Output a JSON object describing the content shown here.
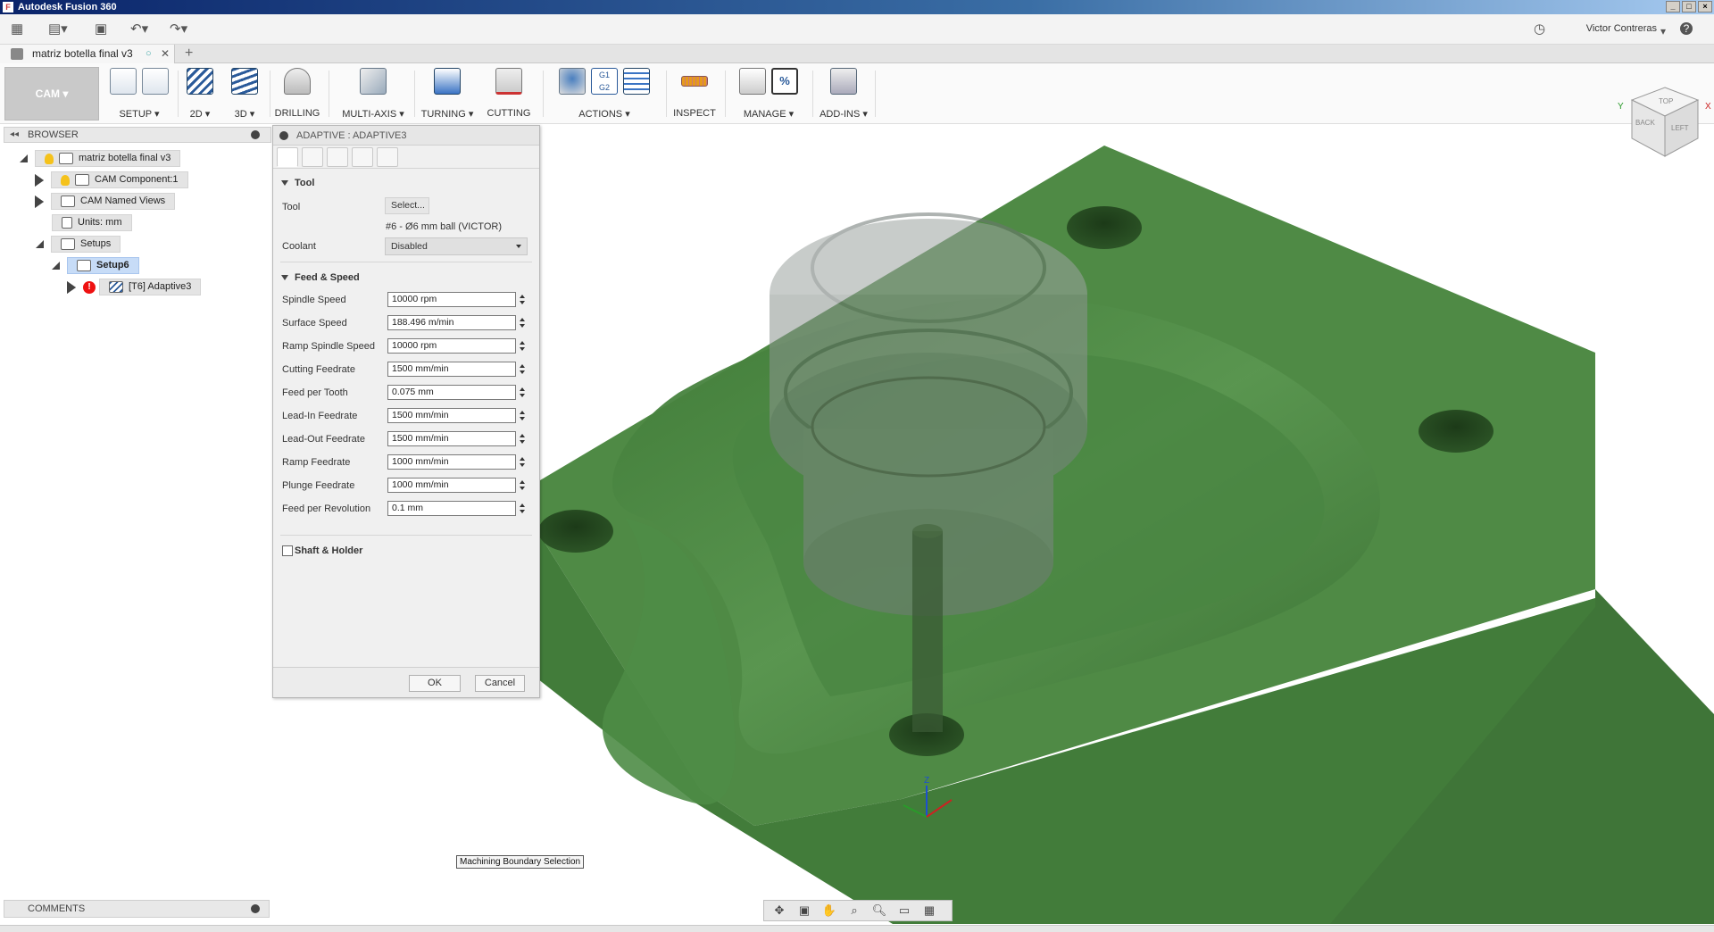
{
  "window": {
    "title": "Autodesk Fusion 360"
  },
  "appbar": {
    "user": "Victor Contreras",
    "help": "?"
  },
  "document_tab": {
    "name": "matriz botella final v3"
  },
  "toolbar": {
    "workspace": "CAM",
    "groups": [
      {
        "label": "SETUP"
      },
      {
        "label": "2D"
      },
      {
        "label": "3D"
      },
      {
        "label": "DRILLING"
      },
      {
        "label": "MULTI-AXIS"
      },
      {
        "label": "TURNING"
      },
      {
        "label": "CUTTING"
      },
      {
        "label": "ACTIONS"
      },
      {
        "label": "INSPECT"
      },
      {
        "label": "MANAGE"
      },
      {
        "label": "ADD-INS"
      }
    ]
  },
  "viewcube": {
    "faces": [
      "TOP",
      "BACK",
      "LEFT"
    ],
    "axes": [
      "Y",
      "X"
    ]
  },
  "browser": {
    "title": "BROWSER",
    "nodes": [
      {
        "label": "matriz botella final v3"
      },
      {
        "label": "CAM Component:1"
      },
      {
        "label": "CAM Named Views"
      },
      {
        "label": "Units: mm"
      },
      {
        "label": "Setups"
      },
      {
        "label": "Setup6"
      },
      {
        "label": "[T6] Adaptive3"
      }
    ]
  },
  "comments": {
    "title": "COMMENTS"
  },
  "dialog": {
    "title": "ADAPTIVE : ADAPTIVE3",
    "tool_section": "Tool",
    "tool_label": "Tool",
    "tool_select": "Select...",
    "tool_desc": "#6 - Ø6 mm ball (VICTOR)",
    "coolant_label": "Coolant",
    "coolant_value": "Disabled",
    "feed_section": "Feed & Speed",
    "fields": [
      {
        "label": "Spindle Speed",
        "value": "10000 rpm"
      },
      {
        "label": "Surface Speed",
        "value": "188.496 m/min"
      },
      {
        "label": "Ramp Spindle Speed",
        "value": "10000 rpm"
      },
      {
        "label": "Cutting Feedrate",
        "value": "1500 mm/min"
      },
      {
        "label": "Feed per Tooth",
        "value": "0.075 mm"
      },
      {
        "label": "Lead-In Feedrate",
        "value": "1500 mm/min"
      },
      {
        "label": "Lead-Out Feedrate",
        "value": "1500 mm/min"
      },
      {
        "label": "Ramp Feedrate",
        "value": "1000 mm/min"
      },
      {
        "label": "Plunge Feedrate",
        "value": "1000 mm/min"
      },
      {
        "label": "Feed per Revolution",
        "value": "0.1 mm"
      }
    ],
    "shaft_label": "Shaft & Holder",
    "ok": "OK",
    "cancel": "Cancel"
  },
  "tooltip": "Machining Boundary Selection",
  "gizmo": {
    "z": "Z"
  },
  "colors": {
    "part": "#4f8a45",
    "part_dark": "#3f7538",
    "highlight": "#c7dcf7"
  }
}
